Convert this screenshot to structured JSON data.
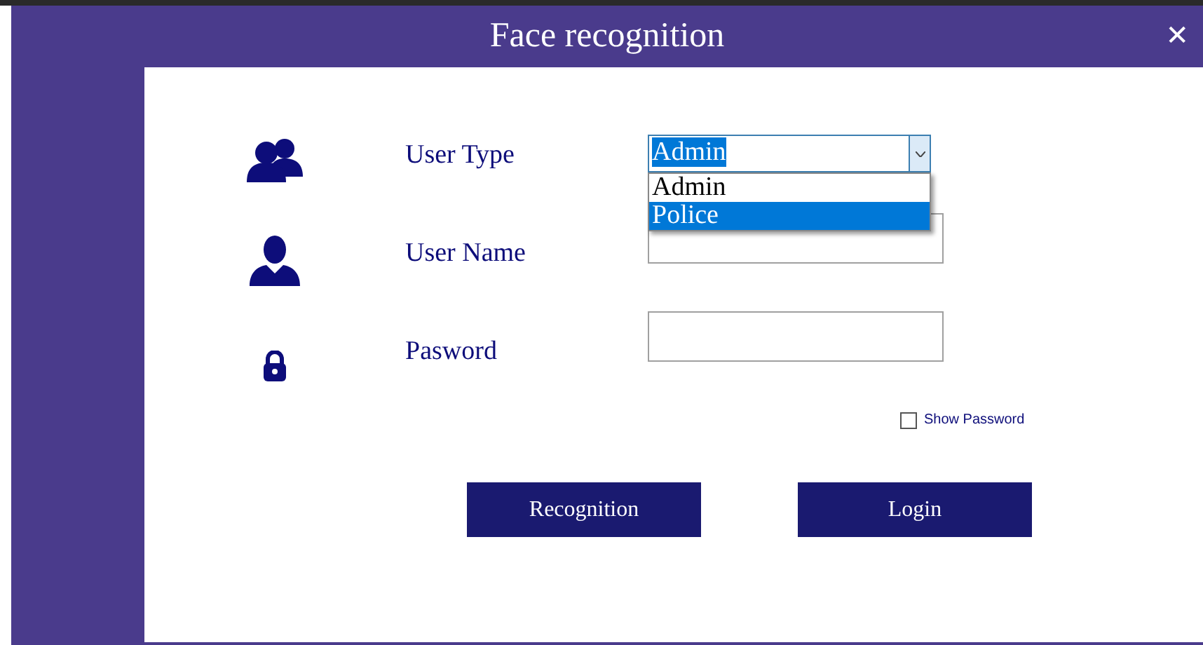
{
  "window": {
    "title": "Face recognition",
    "close": "✕"
  },
  "fields": [
    {
      "kind": "select",
      "label": "User Type",
      "value": "Admin",
      "expanded": true,
      "options": [
        {
          "label": "Admin",
          "highlighted": false
        },
        {
          "label": "Police",
          "highlighted": true
        }
      ]
    },
    {
      "kind": "text",
      "label": "User Name"
    },
    {
      "kind": "password",
      "label": "Pasword"
    }
  ],
  "show_password": {
    "label": "Show Password",
    "checked": false
  },
  "buttons": [
    "Recognition",
    "Login"
  ]
}
